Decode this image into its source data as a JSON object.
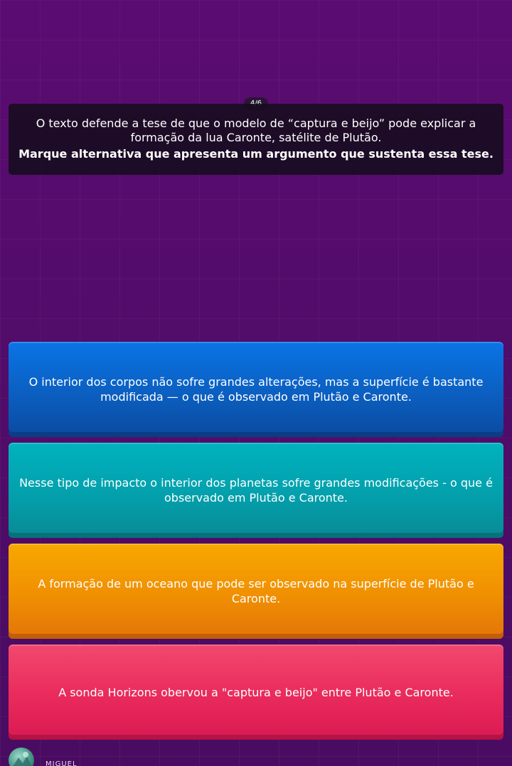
{
  "question": {
    "counter": "4/6",
    "text": "O texto defende a tese de que o modelo de “captura e beijo” pode explicar a formação da lua Caronte, satélite de Plutão.",
    "instruction": "Marque alternativa que apresenta um argumento que sustenta essa tese."
  },
  "options": [
    {
      "text": "O interior dos corpos não sofre grandes alterações, mas a superfície é bastante modificada — o que é observado em Plutão e Caronte.",
      "color": "#0b5fc0"
    },
    {
      "text": "Nesse tipo de impacto o interior dos planetas sofre grandes modificações - o que é observado em Plutão e Caronte.",
      "color": "#03a0ac"
    },
    {
      "text": "A formação de um oceano que pode ser observado na superfície de Plutão e Caronte.",
      "color": "#f08f02"
    },
    {
      "text": "A sonda Horizons obervou a \"captura e beijo\" entre Plutão e Caronte.",
      "color": "#e92a5c"
    }
  ],
  "player": {
    "name": "MIGUEL",
    "avatar_icon": "player-avatar-icon"
  },
  "colors": {
    "background": "#4f0c68",
    "question_box": "#160c1e"
  }
}
